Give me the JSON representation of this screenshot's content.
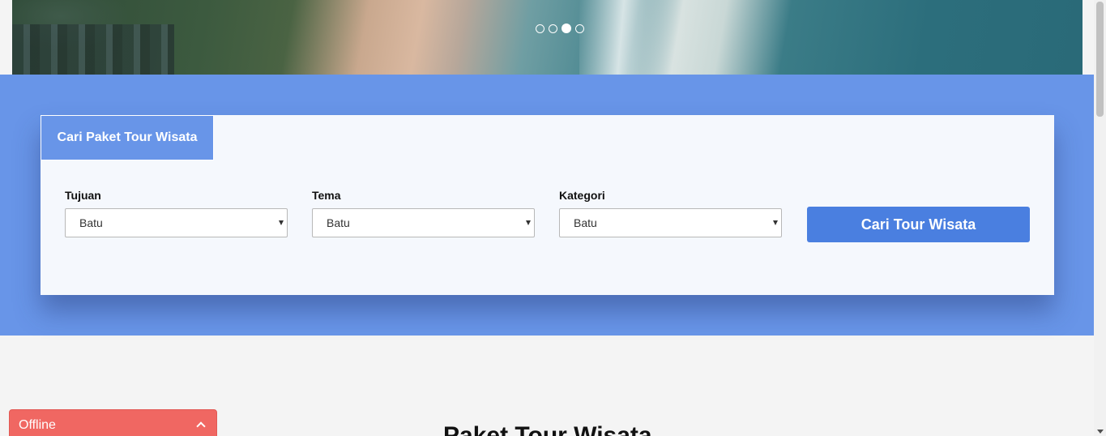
{
  "hero": {
    "slides": 4,
    "active_slide": 3
  },
  "search_card": {
    "tab_label": "Cari Paket Tour Wisata",
    "fields": [
      {
        "label": "Tujuan",
        "value": "Batu"
      },
      {
        "label": "Tema",
        "value": "Batu"
      },
      {
        "label": "Kategori",
        "value": "Batu"
      }
    ],
    "submit_label": "Cari Tour Wisata"
  },
  "section": {
    "title": "Paket Tour Wisata"
  },
  "chat_widget": {
    "status_label": "Offline"
  },
  "colors": {
    "band": "#6895e8",
    "button": "#4a7fe0",
    "offline": "#f06762"
  }
}
